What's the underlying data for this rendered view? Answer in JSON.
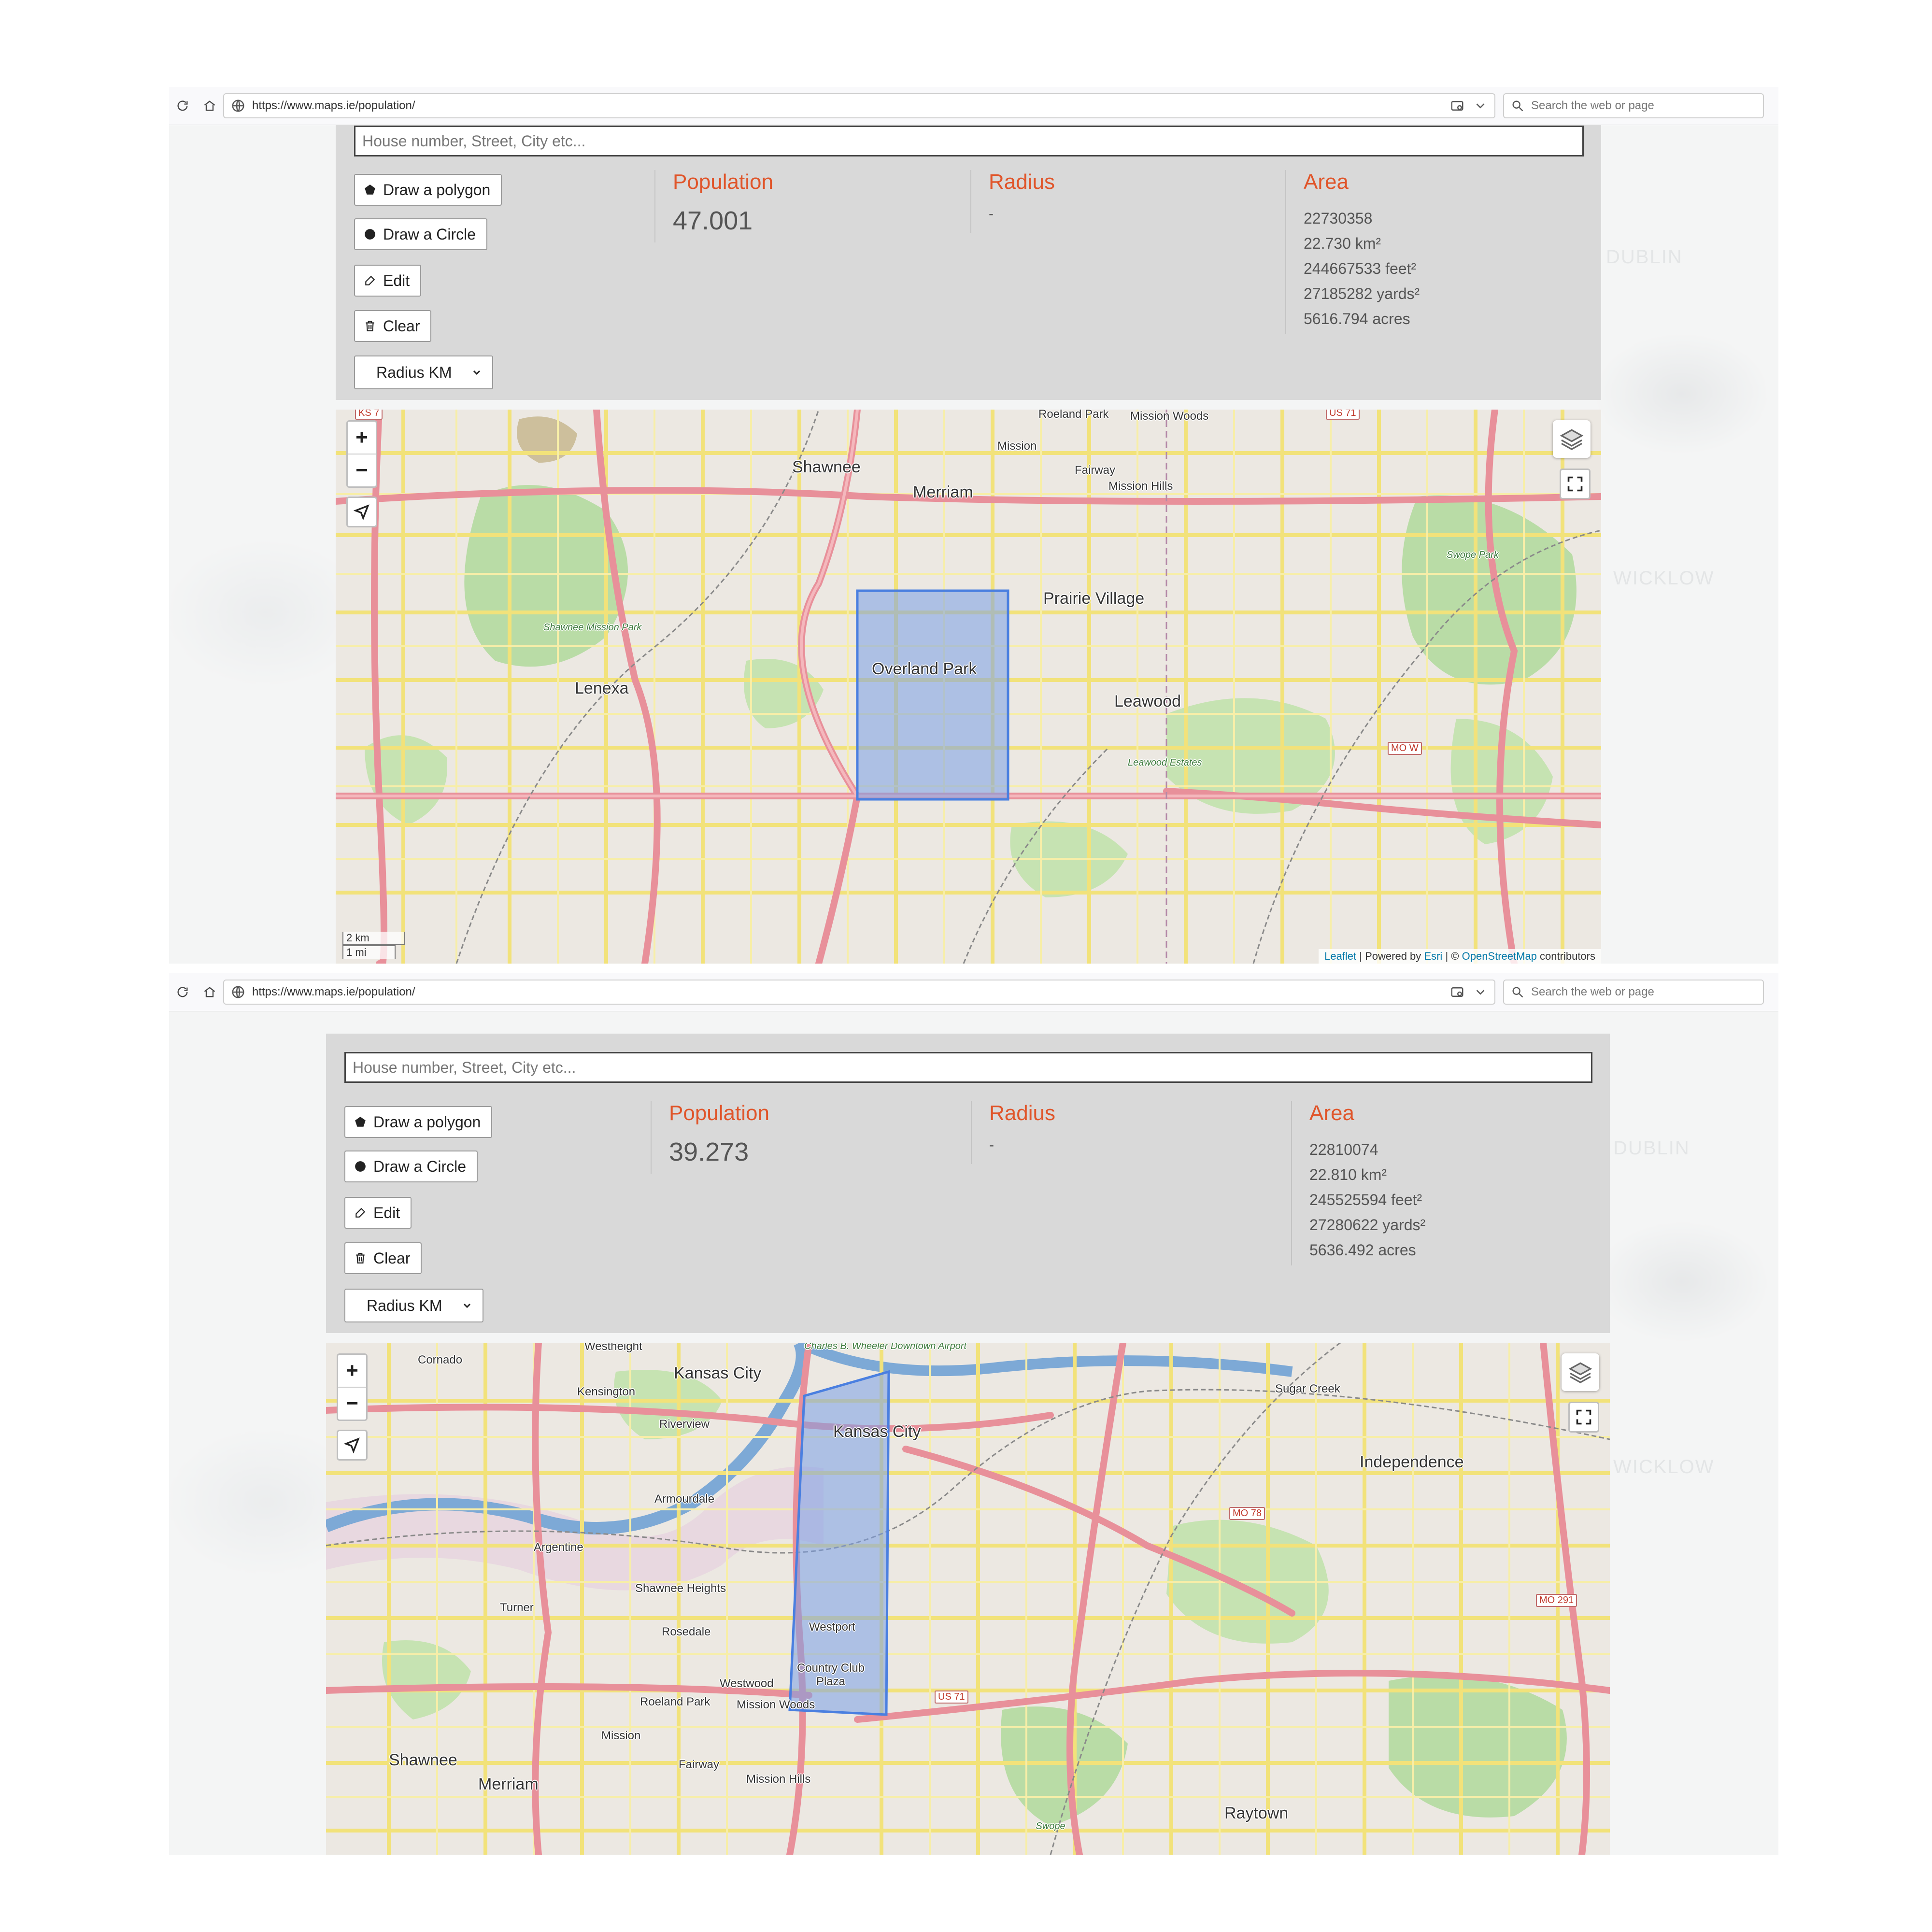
{
  "screenshots": [
    {
      "browser": {
        "url": "https://www.maps.ie/population/",
        "search_placeholder": "Search the web or page"
      },
      "address_placeholder": "House number, Street, City etc...",
      "controls": {
        "draw_polygon": "Draw a polygon",
        "draw_circle": "Draw a Circle",
        "edit": "Edit",
        "clear": "Clear",
        "radius_unit": "Radius KM"
      },
      "stats": {
        "population_label": "Population",
        "population_value": "47.001",
        "radius_label": "Radius",
        "radius_value": "-",
        "area_label": "Area",
        "area_lines": [
          "22730358",
          "22.730 km²",
          "244667533 feet²",
          "27185282 yards²",
          "5616.794 acres"
        ]
      },
      "map": {
        "zoom_in": "+",
        "zoom_out": "−",
        "scale_km": "2 km",
        "scale_mi": "1 mi",
        "attribution": {
          "leaflet": "Leaflet",
          "powered_by": "| Powered by",
          "esri": "Esri",
          "copyright": "| ©",
          "osm": "OpenStreetMap",
          "contributors": "contributors"
        },
        "places": [
          {
            "name": "Shawnee",
            "size": "big"
          },
          {
            "name": "Merriam",
            "size": "big"
          },
          {
            "name": "Mission",
            "size": "small"
          },
          {
            "name": "Roeland Park",
            "size": "small"
          },
          {
            "name": "Mission Woods",
            "size": "small"
          },
          {
            "name": "Fairway",
            "size": "small"
          },
          {
            "name": "Mission Hills",
            "size": "small"
          },
          {
            "name": "Prairie Village",
            "size": "big"
          },
          {
            "name": "Overland Park",
            "size": "big"
          },
          {
            "name": "Lenexa",
            "size": "big"
          },
          {
            "name": "Leawood",
            "size": "big"
          },
          {
            "name": "Leawood Estates",
            "size": "park"
          },
          {
            "name": "Shawnee Mission Park",
            "size": "park"
          },
          {
            "name": "Swope Park",
            "size": "park"
          }
        ],
        "shields": [
          "MO W",
          "US 71",
          "KS 7"
        ]
      }
    },
    {
      "browser": {
        "url": "https://www.maps.ie/population/",
        "search_placeholder": "Search the web or page"
      },
      "address_placeholder": "House number, Street, City etc...",
      "controls": {
        "draw_polygon": "Draw a polygon",
        "draw_circle": "Draw a Circle",
        "edit": "Edit",
        "clear": "Clear",
        "radius_unit": "Radius KM"
      },
      "stats": {
        "population_label": "Population",
        "population_value": "39.273",
        "radius_label": "Radius",
        "radius_value": "-",
        "area_label": "Area",
        "area_lines": [
          "22810074",
          "22.810 km²",
          "245525594 feet²",
          "27280622 yards²",
          "5636.492 acres"
        ]
      },
      "map": {
        "zoom_in": "+",
        "zoom_out": "−",
        "places": [
          {
            "name": "Westheight",
            "size": "small"
          },
          {
            "name": "Cornado",
            "size": "small"
          },
          {
            "name": "Kansas City",
            "size": "big"
          },
          {
            "name": "Kensington",
            "size": "small"
          },
          {
            "name": "Charles B. Wheeler Downtown Airport",
            "size": "park"
          },
          {
            "name": "Kansas City",
            "size": "big"
          },
          {
            "name": "Riverview",
            "size": "small"
          },
          {
            "name": "Sugar Creek",
            "size": "small"
          },
          {
            "name": "Independence",
            "size": "big"
          },
          {
            "name": "Armourdale",
            "size": "small"
          },
          {
            "name": "Argentine",
            "size": "small"
          },
          {
            "name": "Shawnee Heights",
            "size": "small"
          },
          {
            "name": "Turner",
            "size": "small"
          },
          {
            "name": "Rosedale",
            "size": "small"
          },
          {
            "name": "Westport",
            "size": "small"
          },
          {
            "name": "Country Club Plaza",
            "size": "small"
          },
          {
            "name": "Westwood",
            "size": "small"
          },
          {
            "name": "Roeland Park",
            "size": "small"
          },
          {
            "name": "Mission Woods",
            "size": "small"
          },
          {
            "name": "Mission",
            "size": "small"
          },
          {
            "name": "Fairway",
            "size": "small"
          },
          {
            "name": "Mission Hills",
            "size": "small"
          },
          {
            "name": "Shawnee",
            "size": "big"
          },
          {
            "name": "Merriam",
            "size": "big"
          },
          {
            "name": "Raytown",
            "size": "big"
          },
          {
            "name": "Swope",
            "size": "park"
          }
        ],
        "shields": [
          "MO 78",
          "MO 291",
          "US 71"
        ]
      }
    }
  ],
  "background_words": [
    "DUBLIN",
    "WICKLOW"
  ],
  "colors": {
    "accent": "#e0552a",
    "panel": "#d9d9d9",
    "selection_fill": "#7a9ee6",
    "selection_stroke": "#4a7fe0",
    "road_primary": "#e8909a",
    "road_secondary": "#f2e27a"
  }
}
